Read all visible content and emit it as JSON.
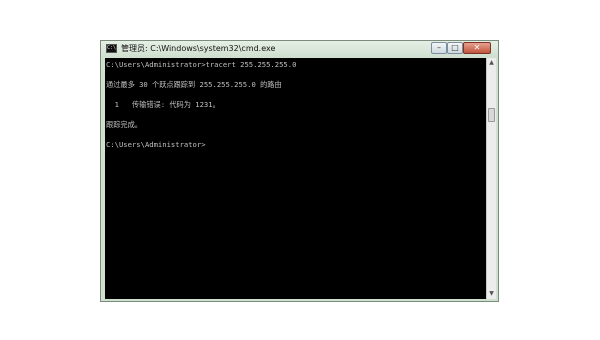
{
  "window": {
    "title": "管理员: C:\\Windows\\system32\\cmd.exe",
    "app_icon_label": "C:\\",
    "buttons": {
      "minimize": "–",
      "maximize": "□",
      "close": "✕"
    }
  },
  "console": {
    "lines": [
      "C:\\Users\\Administrator>tracert 255.255.255.0",
      "",
      "通过最多 30 个跃点跟踪到 255.255.255.0 的路由",
      "",
      "  1   传输错误: 代码为 1231。",
      "",
      "跟踪完成。",
      "",
      "C:\\Users\\Administrator>"
    ]
  },
  "scrollbar": {
    "up": "▲",
    "down": "▼"
  }
}
